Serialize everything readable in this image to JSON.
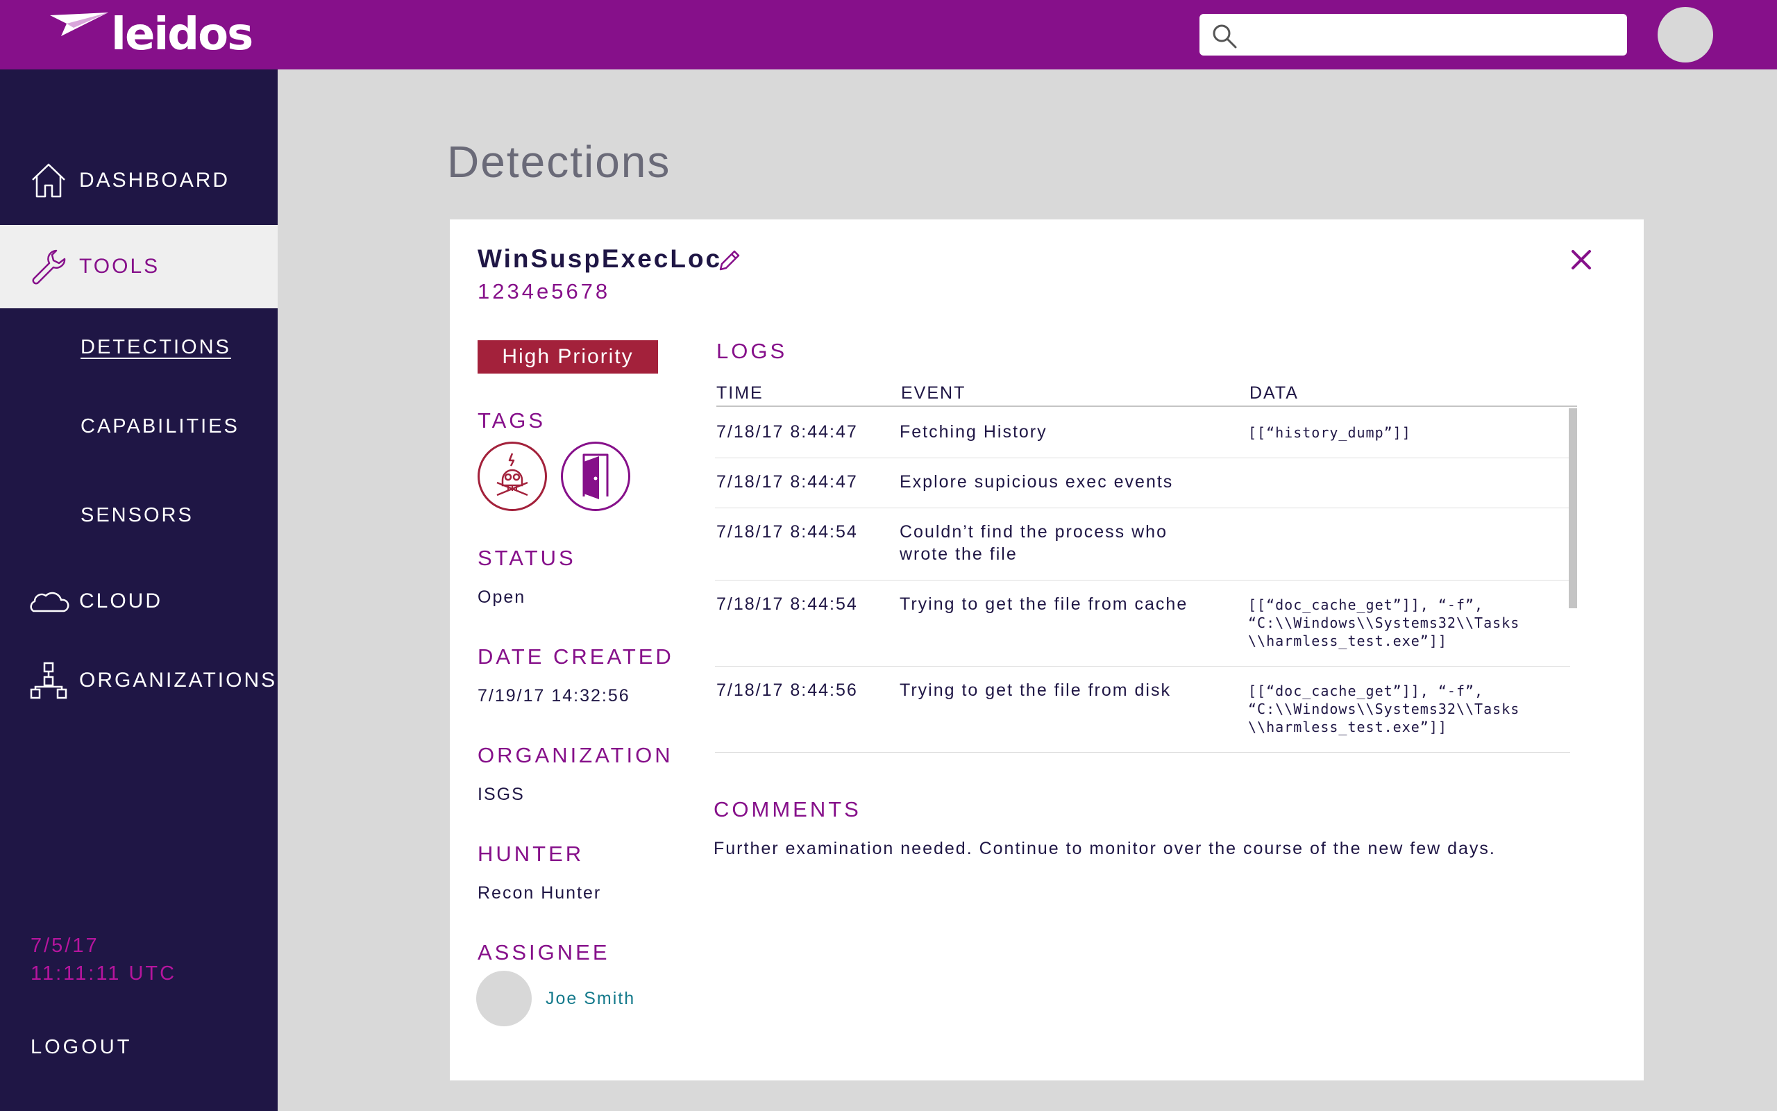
{
  "brand": {
    "name": "leidos"
  },
  "search": {
    "placeholder": ""
  },
  "sidebar": {
    "items": [
      {
        "label": "DASHBOARD",
        "icon": "home-icon"
      },
      {
        "label": "TOOLS",
        "icon": "wrench-icon"
      },
      {
        "label": "CLOUD",
        "icon": "cloud-icon"
      },
      {
        "label": "ORGANIZATIONS",
        "icon": "org-chart-icon"
      }
    ],
    "subitems": [
      "DETECTIONS",
      "CAPABILITIES",
      "SENSORS"
    ],
    "date": "7/5/17",
    "time": "11:11:11 UTC",
    "logout": "LOGOUT"
  },
  "page": {
    "title": "Detections"
  },
  "detection": {
    "name": "WinSuspExecLoc",
    "id": "1234e5678",
    "priority": "High Priority",
    "tags_label": "TAGS",
    "tags": [
      "skull-icon",
      "door-icon"
    ],
    "status_label": "STATUS",
    "status": "Open",
    "date_label": "DATE CREATED",
    "date_created": "7/19/17 14:32:56",
    "org_label": "ORGANIZATION",
    "organization": "ISGS",
    "hunter_label": "HUNTER",
    "hunter": "Recon Hunter",
    "assignee_label": "ASSIGNEE",
    "assignee": "Joe Smith"
  },
  "logs": {
    "title": "LOGS",
    "columns": [
      "TIME",
      "EVENT",
      "DATA"
    ],
    "rows": [
      {
        "time": "7/18/17 8:44:47",
        "event": "Fetching History",
        "data": "[[“history_dump”]]"
      },
      {
        "time": "7/18/17 8:44:47",
        "event": "Explore supicious exec events",
        "data": ""
      },
      {
        "time": "7/18/17 8:44:54",
        "event": "Couldn’t find the process who wrote the file",
        "data": ""
      },
      {
        "time": "7/18/17 8:44:54",
        "event": "Trying to get the file from cache",
        "data": "[[“doc_cache_get”]], “-f”,\n“C:\\\\Windows\\\\Systems32\\\\Tasks\n\\\\harmless_test.exe”]]"
      },
      {
        "time": "7/18/17 8:44:56",
        "event": "Trying to get the file from disk",
        "data": "[[“doc_cache_get”]], “-f”,\n“C:\\\\Windows\\\\Systems32\\\\Tasks\n\\\\harmless_test.exe”]]"
      }
    ]
  },
  "comments": {
    "title": "COMMENTS",
    "text": "Further examination needed. Continue to monitor over the course of the new few days."
  },
  "colors": {
    "brand_purple": "#86108a",
    "sidebar_navy": "#1f1645",
    "priority_red": "#a3213b",
    "assignee_teal": "#157a8c"
  }
}
